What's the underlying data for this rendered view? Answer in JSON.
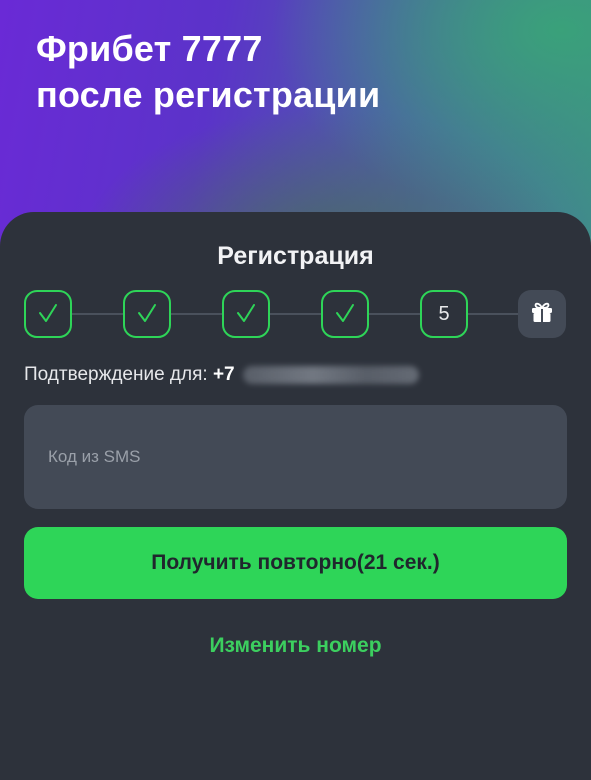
{
  "hero": {
    "title_line1": "Фрибет 7777",
    "title_line2": "после регистрации"
  },
  "registration": {
    "title": "Регистрация",
    "steps": [
      {
        "state": "done",
        "icon": "check-icon"
      },
      {
        "state": "done",
        "icon": "check-icon"
      },
      {
        "state": "done",
        "icon": "check-icon"
      },
      {
        "state": "done",
        "icon": "check-icon"
      },
      {
        "state": "current",
        "label": "5"
      },
      {
        "state": "reward",
        "icon": "gift-icon"
      }
    ],
    "confirm_label": "Подтверждение для:",
    "phone_prefix": "+7",
    "sms_placeholder": "Код из SMS",
    "sms_value": "",
    "resend_label": "Получить повторно(21 сек.)",
    "change_number_label": "Изменить номер"
  },
  "colors": {
    "accent_green": "#2ed558",
    "card_bg": "#2d323b",
    "field_bg": "#434a56"
  }
}
